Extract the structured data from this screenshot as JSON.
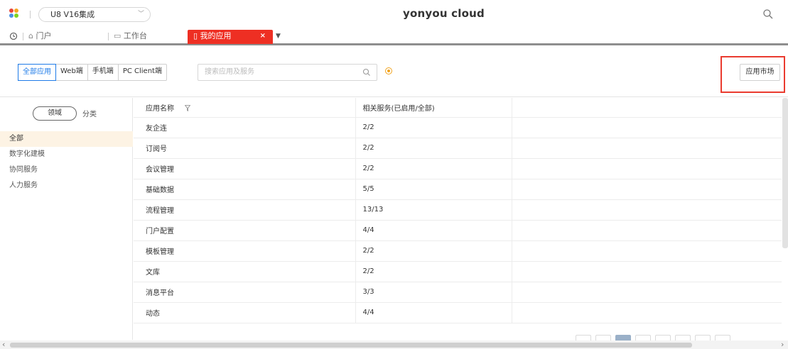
{
  "topbar": {
    "tenant_label": "U8 V16集成",
    "brand": "yonyou cloud",
    "logo_colors": [
      "#e8463a",
      "#f5a623",
      "#4a90e2",
      "#7ed321"
    ]
  },
  "tabs": [
    {
      "label": "门户",
      "icon": "home-icon"
    },
    {
      "label": "工作台",
      "icon": "monitor-icon"
    },
    {
      "label": "我的应用",
      "icon": "document-icon",
      "active": true,
      "close": "×"
    }
  ],
  "filter": {
    "segments": [
      "全部应用",
      "Web端",
      "手机端",
      "PC Client端"
    ],
    "active_segment": "全部应用",
    "search_placeholder": "搜索应用及服务",
    "market_button": "应用市场"
  },
  "sidebar": {
    "toggle_active": "领域",
    "toggle_other": "分类",
    "items": [
      "全部",
      "数字化建模",
      "协同服务",
      "人力服务"
    ],
    "active_item": "全部"
  },
  "table": {
    "headers": [
      "应用名称",
      "相关服务(已启用/全部)"
    ],
    "rows": [
      {
        "name": "友企连",
        "services": "2/2"
      },
      {
        "name": "订阅号",
        "services": "2/2"
      },
      {
        "name": "会议管理",
        "services": "2/2"
      },
      {
        "name": "基础数据",
        "services": "5/5"
      },
      {
        "name": "流程管理",
        "services": "13/13"
      },
      {
        "name": "门户配置",
        "services": "4/4"
      },
      {
        "name": "模板管理",
        "services": "2/2"
      },
      {
        "name": "文库",
        "services": "2/2"
      },
      {
        "name": "消息平台",
        "services": "3/3"
      },
      {
        "name": "动态",
        "services": "4/4"
      }
    ]
  },
  "colors": {
    "accent_red": "#ee2f23",
    "accent_blue": "#1e7be8",
    "highlight_box": "#ea3b2f"
  }
}
